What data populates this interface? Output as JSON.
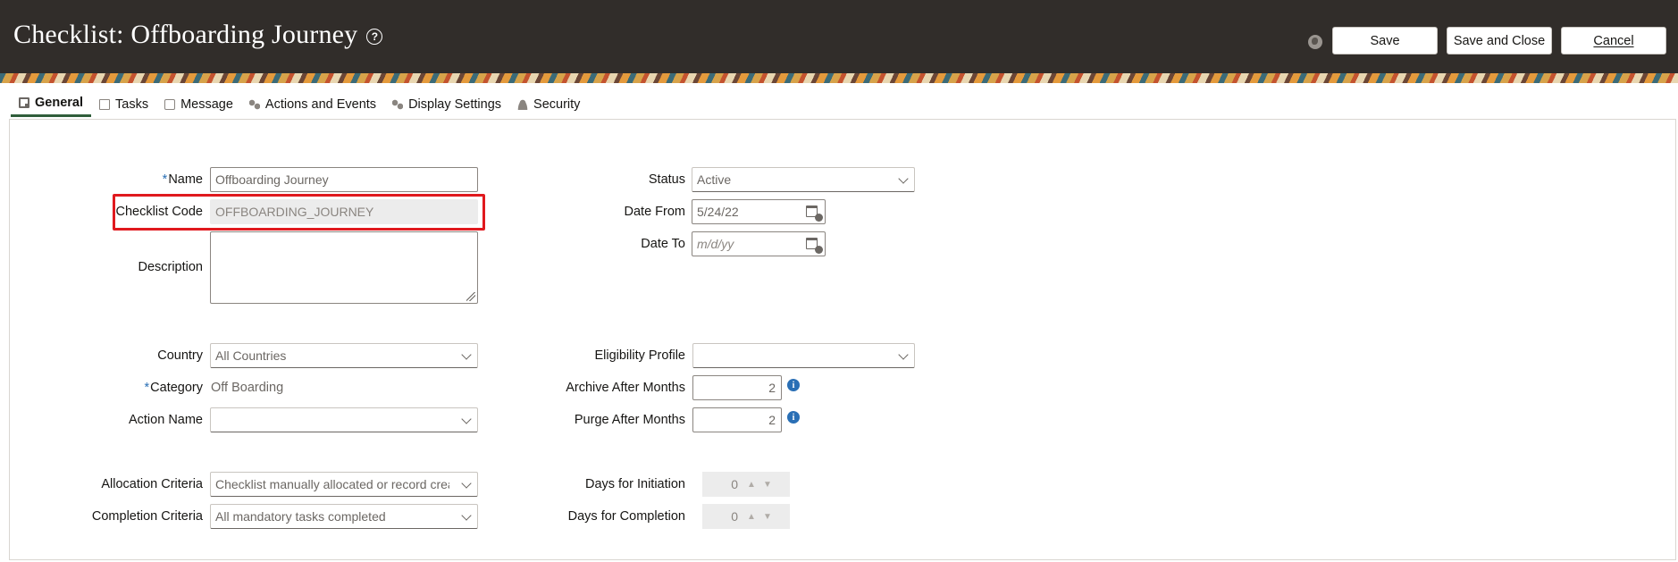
{
  "header": {
    "title": "Checklist: Offboarding Journey",
    "help_icon": "help-circle-icon",
    "globe_icon": "globe-icon",
    "buttons": {
      "save": "Save",
      "save_and_close": "Save and Close",
      "cancel": "Cancel"
    }
  },
  "tabs": [
    {
      "label": "General",
      "icon": "general-icon",
      "active": true
    },
    {
      "label": "Tasks",
      "icon": "tasks-icon"
    },
    {
      "label": "Message",
      "icon": "message-icon"
    },
    {
      "label": "Actions and Events",
      "icon": "actions-icon"
    },
    {
      "label": "Display Settings",
      "icon": "display-settings-icon"
    },
    {
      "label": "Security",
      "icon": "security-icon"
    }
  ],
  "form": {
    "name": {
      "label": "Name",
      "required": "*",
      "value": "Offboarding Journey"
    },
    "checklist_code": {
      "label": "Checklist Code",
      "value": "OFFBOARDING_JOURNEY"
    },
    "description": {
      "label": "Description",
      "value": ""
    },
    "status": {
      "label": "Status",
      "value": "Active"
    },
    "date_from": {
      "label": "Date From",
      "value": "5/24/22"
    },
    "date_to": {
      "label": "Date To",
      "placeholder": "m/d/yy"
    },
    "country": {
      "label": "Country",
      "value": "All Countries"
    },
    "category": {
      "label": "Category",
      "required": "*",
      "value": "Off Boarding"
    },
    "action_name": {
      "label": "Action Name",
      "value": ""
    },
    "eligibility_profile": {
      "label": "Eligibility Profile",
      "value": ""
    },
    "archive_after_months": {
      "label": "Archive After Months",
      "value": "2"
    },
    "purge_after_months": {
      "label": "Purge After Months",
      "value": "2"
    },
    "allocation_criteria": {
      "label": "Allocation Criteria",
      "value": "Checklist manually allocated or record created"
    },
    "completion_criteria": {
      "label": "Completion Criteria",
      "value": "All mandatory tasks completed"
    },
    "days_for_initiation": {
      "label": "Days for Initiation",
      "value": "0"
    },
    "days_for_completion": {
      "label": "Days for Completion",
      "value": "0"
    }
  },
  "colors": {
    "header_bg": "#312d2a",
    "highlight": "#e0191e",
    "required_mark": "#2a6fb5",
    "active_tab_underline": "#2f5d3a"
  }
}
